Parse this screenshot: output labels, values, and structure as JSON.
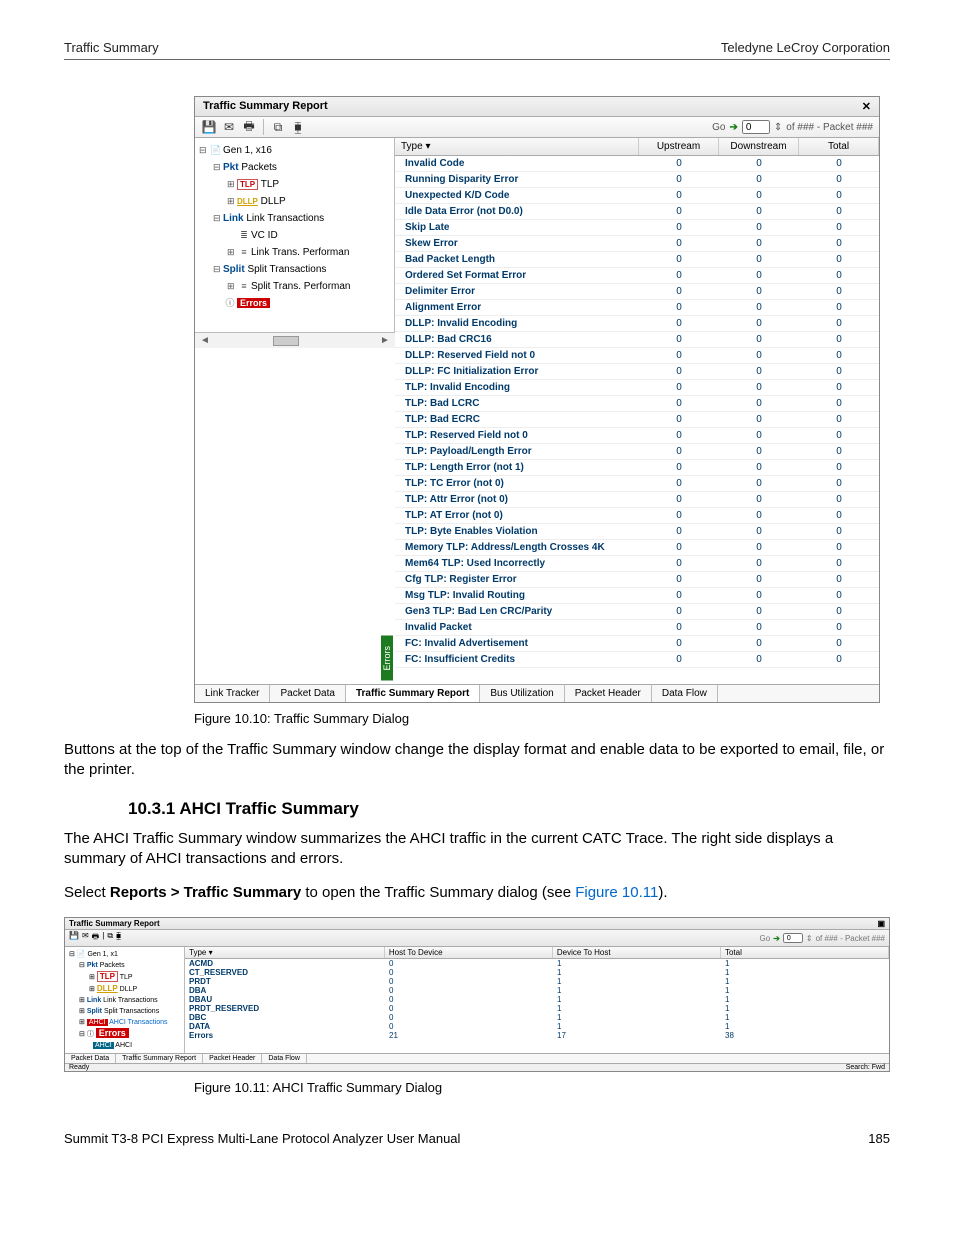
{
  "header": {
    "left": "Traffic Summary",
    "right": "Teledyne LeCroy Corporation"
  },
  "dialog1": {
    "title": "Traffic Summary Report",
    "close_glyph": "✕",
    "go_label": "Go",
    "go_value": "0",
    "go_suffix": "of ### - Packet ###",
    "tree": {
      "n0": "Gen 1, x16",
      "n1": "Packets",
      "n1p": "Pkt",
      "n2": "TLP",
      "n3": "DLLP",
      "n4": "Link Transactions",
      "n4p": "Link",
      "n5": "VC ID",
      "n6": "Link Trans. Performan",
      "n7": "Split Transactions",
      "n7p": "Split",
      "n8": "Split Trans. Performan",
      "n9": "Errors"
    },
    "table": {
      "headers": {
        "type": "Type",
        "up": "Upstream",
        "down": "Downstream",
        "total": "Total",
        "sort_glyph": "▾"
      },
      "side_tab": "Errors",
      "rows": [
        {
          "t": "Invalid Code",
          "u": "0",
          "d": "0",
          "tot": "0"
        },
        {
          "t": "Running Disparity Error",
          "u": "0",
          "d": "0",
          "tot": "0"
        },
        {
          "t": "Unexpected K/D Code",
          "u": "0",
          "d": "0",
          "tot": "0"
        },
        {
          "t": "Idle Data Error (not D0.0)",
          "u": "0",
          "d": "0",
          "tot": "0"
        },
        {
          "t": "Skip Late",
          "u": "0",
          "d": "0",
          "tot": "0"
        },
        {
          "t": "Skew Error",
          "u": "0",
          "d": "0",
          "tot": "0"
        },
        {
          "t": "Bad Packet Length",
          "u": "0",
          "d": "0",
          "tot": "0"
        },
        {
          "t": "Ordered Set Format Error",
          "u": "0",
          "d": "0",
          "tot": "0"
        },
        {
          "t": "Delimiter Error",
          "u": "0",
          "d": "0",
          "tot": "0"
        },
        {
          "t": "Alignment Error",
          "u": "0",
          "d": "0",
          "tot": "0"
        },
        {
          "t": "DLLP: Invalid Encoding",
          "u": "0",
          "d": "0",
          "tot": "0"
        },
        {
          "t": "DLLP: Bad CRC16",
          "u": "0",
          "d": "0",
          "tot": "0"
        },
        {
          "t": "DLLP: Reserved Field not 0",
          "u": "0",
          "d": "0",
          "tot": "0"
        },
        {
          "t": "DLLP: FC Initialization Error",
          "u": "0",
          "d": "0",
          "tot": "0"
        },
        {
          "t": "TLP: Invalid Encoding",
          "u": "0",
          "d": "0",
          "tot": "0"
        },
        {
          "t": "TLP: Bad LCRC",
          "u": "0",
          "d": "0",
          "tot": "0"
        },
        {
          "t": "TLP: Bad ECRC",
          "u": "0",
          "d": "0",
          "tot": "0"
        },
        {
          "t": "TLP: Reserved Field not 0",
          "u": "0",
          "d": "0",
          "tot": "0"
        },
        {
          "t": "TLP: Payload/Length Error",
          "u": "0",
          "d": "0",
          "tot": "0"
        },
        {
          "t": "TLP: Length Error (not 1)",
          "u": "0",
          "d": "0",
          "tot": "0"
        },
        {
          "t": "TLP: TC Error (not 0)",
          "u": "0",
          "d": "0",
          "tot": "0"
        },
        {
          "t": "TLP: Attr Error (not 0)",
          "u": "0",
          "d": "0",
          "tot": "0"
        },
        {
          "t": "TLP: AT Error (not 0)",
          "u": "0",
          "d": "0",
          "tot": "0"
        },
        {
          "t": "TLP: Byte Enables Violation",
          "u": "0",
          "d": "0",
          "tot": "0"
        },
        {
          "t": "Memory TLP: Address/Length Crosses 4K",
          "u": "0",
          "d": "0",
          "tot": "0"
        },
        {
          "t": "Mem64 TLP: Used Incorrectly",
          "u": "0",
          "d": "0",
          "tot": "0"
        },
        {
          "t": "Cfg TLP: Register Error",
          "u": "0",
          "d": "0",
          "tot": "0"
        },
        {
          "t": "Msg TLP: Invalid Routing",
          "u": "0",
          "d": "0",
          "tot": "0"
        },
        {
          "t": "Gen3 TLP: Bad Len CRC/Parity",
          "u": "0",
          "d": "0",
          "tot": "0"
        },
        {
          "t": "Invalid Packet",
          "u": "0",
          "d": "0",
          "tot": "0"
        },
        {
          "t": "FC: Invalid Advertisement",
          "u": "0",
          "d": "0",
          "tot": "0"
        },
        {
          "t": "FC: Insufficient Credits",
          "u": "0",
          "d": "0",
          "tot": "0"
        }
      ]
    },
    "tabs": [
      "Link Tracker",
      "Packet Data",
      "Traffic Summary Report",
      "Bus Utilization",
      "Packet Header",
      "Data Flow"
    ]
  },
  "cap1": "Figure 10.10:  Traffic Summary Dialog",
  "para1": "Buttons at the top of the Traffic Summary window change the display format and enable data to be exported to email, file, or the printer.",
  "sec_heading": "10.3.1  AHCI Traffic Summary",
  "para2": "The AHCI Traffic Summary window summarizes the AHCI traffic in the current CATC Trace. The right side displays a summary of AHCI transactions and errors.",
  "para3a": "Select ",
  "para3b": "Reports > Traffic Summary",
  "para3c": " to open the Traffic Summary dialog (see ",
  "para3link": "Figure 10.11",
  "para3d": ").",
  "dialog2": {
    "title": "Traffic Summary Report",
    "go_label": "Go",
    "go_value": "0",
    "go_suffix": "of ### - Packet ###",
    "tree": {
      "n0": "Gen 1, x1",
      "n1": "Packets",
      "n1p": "Pkt",
      "n2": "TLP",
      "n3": "DLLP",
      "n4": "Link Transactions",
      "n4p": "Link",
      "n5": "Split Transactions",
      "n5p": "Split",
      "n6": "AHCI Transactions",
      "n6p": "AHCI",
      "n7": "Errors",
      "n8": "AHCI",
      "n8p": "AHCI"
    },
    "headers": {
      "type": "Type",
      "h2d": "Host To Device",
      "d2h": "Device To Host",
      "total": "Total",
      "sort_glyph": "▾"
    },
    "rows": [
      {
        "t": "ACMD",
        "a": "0",
        "b": "1",
        "c": "1"
      },
      {
        "t": "CT_RESERVED",
        "a": "0",
        "b": "1",
        "c": "1"
      },
      {
        "t": "PRDT",
        "a": "0",
        "b": "1",
        "c": "1"
      },
      {
        "t": "DBA",
        "a": "0",
        "b": "1",
        "c": "1"
      },
      {
        "t": "DBAU",
        "a": "0",
        "b": "1",
        "c": "1"
      },
      {
        "t": "PRDT_RESERVED",
        "a": "0",
        "b": "1",
        "c": "1"
      },
      {
        "t": "DBC",
        "a": "0",
        "b": "1",
        "c": "1"
      },
      {
        "t": "DATA",
        "a": "0",
        "b": "1",
        "c": "1"
      },
      {
        "t": "Errors",
        "a": "21",
        "b": "17",
        "c": "38"
      }
    ],
    "tabs": [
      "Packet Data",
      "Traffic Summary Report",
      "Packet Header",
      "Data Flow"
    ],
    "status_left": "Ready",
    "status_right": "Search: Fwd"
  },
  "cap2": "Figure 10.11:  AHCI Traffic Summary Dialog",
  "footer": {
    "left": "Summit T3-8 PCI Express Multi-Lane Protocol Analyzer User Manual",
    "right": "185"
  }
}
